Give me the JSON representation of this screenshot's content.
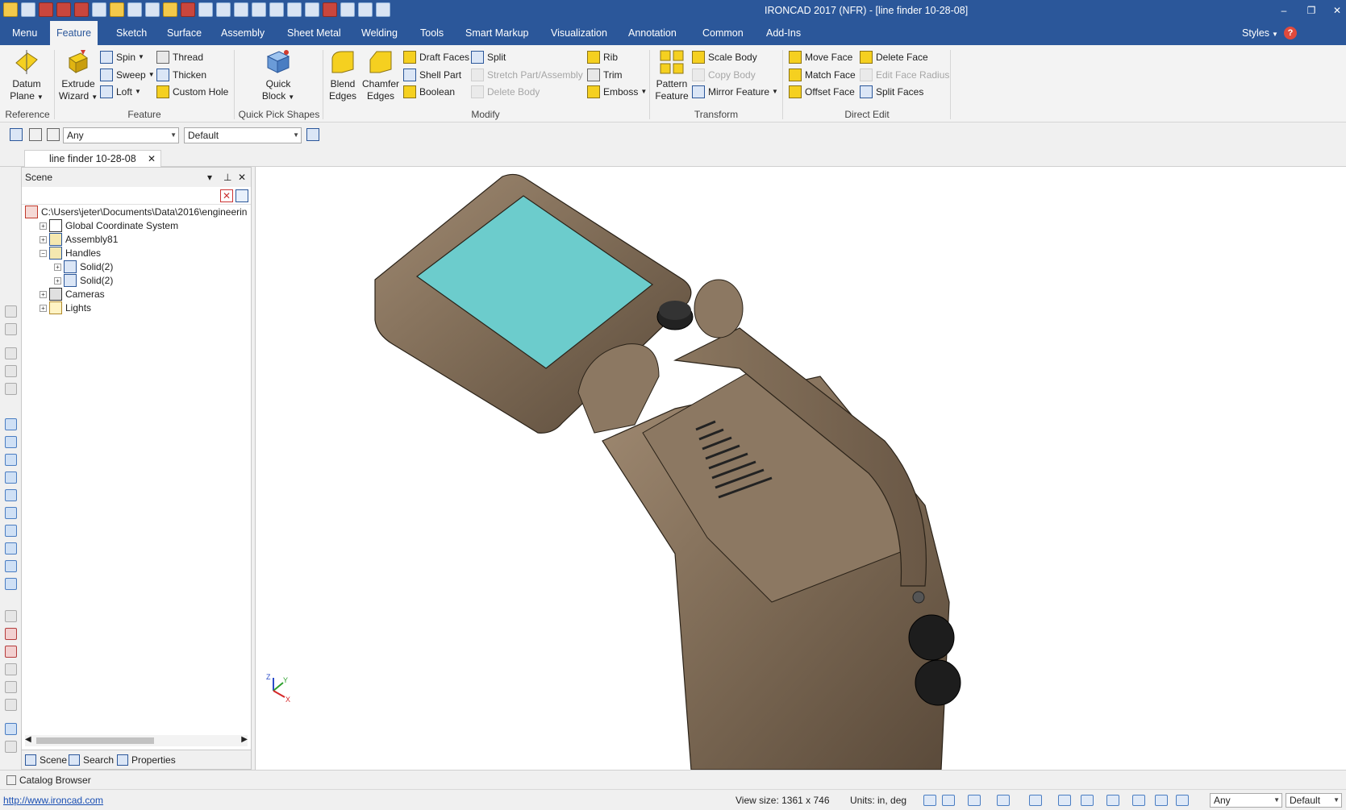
{
  "window": {
    "title": "IRONCAD 2017 (NFR) - [line finder 10-28-08]",
    "controls": [
      "–",
      "❐",
      "✕"
    ]
  },
  "tabs": [
    "Menu",
    "Feature",
    "Sketch",
    "Surface",
    "Assembly",
    "Sheet Metal",
    "Welding",
    "Tools",
    "Smart Markup",
    "Visualization",
    "Annotation",
    "Common",
    "Add-Ins"
  ],
  "active_tab": "Feature",
  "tab_right": {
    "styles": "Styles",
    "help": "?"
  },
  "ribbon": {
    "groups": {
      "reference": "Reference",
      "feature": "Feature",
      "quick_pick": "Quick Pick Shapes",
      "modify": "Modify",
      "transform": "Transform",
      "direct_edit": "Direct Edit"
    },
    "reference": {
      "datum_plane_1": "Datum",
      "datum_plane_2": "Plane"
    },
    "feature": {
      "extrude_1": "Extrude",
      "extrude_2": "Wizard",
      "spin": "Spin",
      "sweep": "Sweep",
      "loft": "Loft",
      "thread": "Thread",
      "thicken": "Thicken",
      "custom_hole": "Custom Hole"
    },
    "quick_pick": {
      "quick_1": "Quick",
      "quick_2": "Block"
    },
    "modify": {
      "blend_1": "Blend",
      "blend_2": "Edges",
      "chamfer_1": "Chamfer",
      "chamfer_2": "Edges",
      "draft_faces": "Draft Faces",
      "shell_part": "Shell Part",
      "boolean": "Boolean",
      "split": "Split",
      "stretch": "Stretch Part/Assembly",
      "delete_body": "Delete Body",
      "rib": "Rib",
      "trim": "Trim",
      "emboss": "Emboss"
    },
    "transform": {
      "pattern_1": "Pattern",
      "pattern_2": "Feature",
      "scale_body": "Scale Body",
      "copy_body": "Copy Body",
      "mirror_feature": "Mirror Feature"
    },
    "direct_edit": {
      "move_face": "Move Face",
      "match_face": "Match Face",
      "offset_face": "Offset Face",
      "delete_face": "Delete Face",
      "edit_face_radius": "Edit Face Radius",
      "split_faces": "Split Faces"
    }
  },
  "selection_bar": {
    "filter": "Any",
    "style": "Default"
  },
  "document_tab": {
    "name": "line finder 10-28-08",
    "close": "✕"
  },
  "scene": {
    "title": "Scene",
    "tree": [
      {
        "label": "C:\\Users\\jeter\\Documents\\Data\\2016\\engineerin",
        "level": 0,
        "expander": "",
        "icon": "scene-root-icon"
      },
      {
        "label": "Global Coordinate System",
        "level": 1,
        "expander": "+",
        "icon": "coordinate-system-icon"
      },
      {
        "label": "Assembly81",
        "level": 1,
        "expander": "+",
        "icon": "assembly-icon"
      },
      {
        "label": "Handles",
        "level": 1,
        "expander": "−",
        "icon": "assembly-icon"
      },
      {
        "label": "Solid(2)",
        "level": 2,
        "expander": "+",
        "icon": "solid-part-icon"
      },
      {
        "label": "Solid(2)",
        "level": 2,
        "expander": "+",
        "icon": "solid-part-icon"
      },
      {
        "label": "Cameras",
        "level": 1,
        "expander": "+",
        "icon": "camera-icon"
      },
      {
        "label": "Lights",
        "level": 1,
        "expander": "+",
        "icon": "light-icon"
      }
    ],
    "bottom_tabs": [
      "Scene",
      "Search",
      "Properties"
    ]
  },
  "viewport": {
    "axis_labels": {
      "x": "X",
      "y": "Y",
      "z": "Z"
    }
  },
  "catalog_browser": "Catalog Browser",
  "status": {
    "link": "http://www.ironcad.com",
    "view_size": "View size: 1361 x  746",
    "units": "Units: in, deg",
    "filter": "Any",
    "style": "Default"
  },
  "colors": {
    "title_bar": "#2b579a",
    "screen_face": "#6ccccc",
    "body": "#7d6a55"
  }
}
